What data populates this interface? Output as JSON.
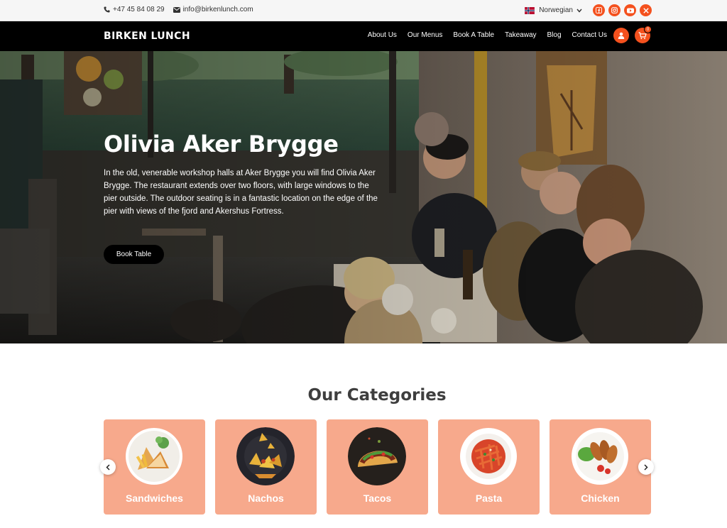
{
  "topbar": {
    "phone": "+47 45 84 08 29",
    "email": "info@birkenlunch.com",
    "language": "Norwegian",
    "social": [
      "facebook-icon",
      "instagram-icon",
      "youtube-icon",
      "x-icon"
    ]
  },
  "nav": {
    "brand": "BIRKEN LUNCH",
    "items": [
      "About Us",
      "Our Menus",
      "Book A Table",
      "Takeaway",
      "Blog",
      "Contact Us"
    ],
    "cart_count": "0"
  },
  "hero": {
    "title": "Olivia Aker Brygge",
    "description": "In the old, venerable workshop halls at Aker Brygge you will find Olivia Aker Brygge. The restaurant extends over two floors, with large windows to the pier outside. The outdoor seating is in a fantastic location on the edge of the pier with views of the fjord and Akershus Fortress.",
    "button": "Book Table"
  },
  "categories": {
    "title": "Our Categories",
    "items": [
      {
        "label": "Sandwiches",
        "icon": "sandwich-plate-image"
      },
      {
        "label": "Nachos",
        "icon": "nachos-image"
      },
      {
        "label": "Tacos",
        "icon": "tacos-image"
      },
      {
        "label": "Pasta",
        "icon": "pasta-plate-image"
      },
      {
        "label": "Chicken",
        "icon": "chicken-plate-image"
      }
    ]
  },
  "colors": {
    "accent": "#f4511e",
    "card": "#f7a98c",
    "navbar": "#000000",
    "topbar": "#f6f6f6"
  }
}
